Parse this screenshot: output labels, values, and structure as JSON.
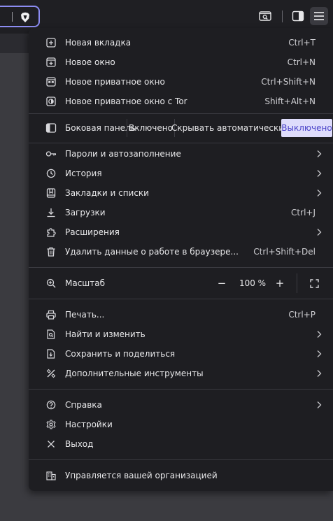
{
  "menu": {
    "new_items": [
      {
        "label": "Новая вкладка",
        "shortcut": "Ctrl+T",
        "icon": "new-tab-icon"
      },
      {
        "label": "Новое окно",
        "shortcut": "Ctrl+N",
        "icon": "new-window-icon"
      },
      {
        "label": "Новое приватное окно",
        "shortcut": "Ctrl+Shift+N",
        "icon": "private-window-icon"
      },
      {
        "label": "Новое приватное окно с Tor",
        "shortcut": "Shift+Alt+N",
        "icon": "tor-window-icon"
      }
    ],
    "sidebar": {
      "label": "Боковая панель",
      "options": [
        "Включено",
        "Скрывать автоматически",
        "Выключено"
      ],
      "selected": "Выключено"
    },
    "browse_items": [
      {
        "label": "Пароли и автозаполнение",
        "icon": "key-icon",
        "submenu": true
      },
      {
        "label": "История",
        "icon": "history-icon",
        "submenu": true
      },
      {
        "label": "Закладки и списки",
        "icon": "bookmarks-icon",
        "submenu": true
      },
      {
        "label": "Загрузки",
        "shortcut": "Ctrl+J",
        "icon": "downloads-icon"
      },
      {
        "label": "Расширения",
        "icon": "extensions-icon",
        "submenu": true
      },
      {
        "label": "Удалить данные о работе в браузере...",
        "shortcut": "Ctrl+Shift+Del",
        "icon": "trash-icon"
      }
    ],
    "zoom": {
      "label": "Масштаб",
      "minus": "−",
      "value": "100 %",
      "plus": "+"
    },
    "tool_items": [
      {
        "label": "Печать...",
        "shortcut": "Ctrl+P",
        "icon": "print-icon"
      },
      {
        "label": "Найти и изменить",
        "icon": "find-icon",
        "submenu": true
      },
      {
        "label": "Сохранить и поделиться",
        "icon": "save-share-icon",
        "submenu": true
      },
      {
        "label": "Дополнительные инструменты",
        "icon": "tools-icon",
        "submenu": true
      }
    ],
    "help_items": [
      {
        "label": "Справка",
        "icon": "help-icon",
        "submenu": true
      },
      {
        "label": "Настройки",
        "icon": "settings-icon"
      },
      {
        "label": "Выход",
        "icon": "close-icon"
      }
    ],
    "managed": {
      "label": "Управляется вашей организацией",
      "icon": "organization-icon"
    }
  },
  "colors": {
    "accent": "#8c8cf2",
    "selected_bg": "#dedcfb",
    "selected_text": "#4a42c9",
    "menu_bg": "#1e1e22"
  }
}
